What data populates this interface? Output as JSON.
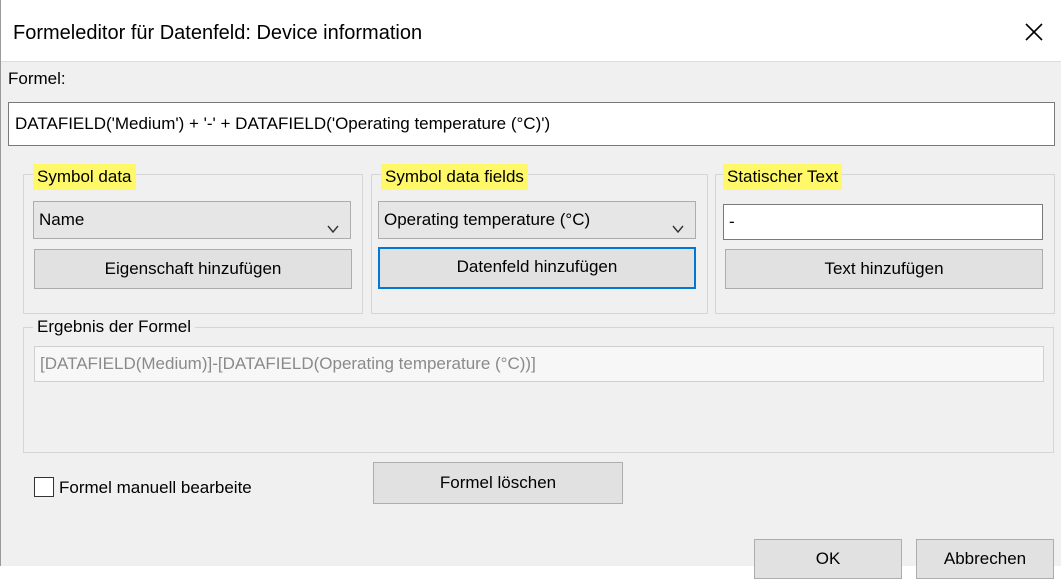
{
  "window": {
    "title": "Formeleditor für Datenfeld: Device information"
  },
  "formula": {
    "label": "Formel:",
    "value": "DATAFIELD('Medium') + '-' + DATAFIELD('Operating temperature (°C)')"
  },
  "symbol_data": {
    "title": "Symbol data",
    "selected": "Name",
    "button": "Eigenschaft hinzufügen"
  },
  "symbol_data_fields": {
    "title": "Symbol data fields",
    "selected": "Operating temperature (°C)",
    "button": "Datenfeld hinzufügen"
  },
  "static_text": {
    "title": "Statischer Text",
    "value": "-",
    "button": "Text hinzufügen"
  },
  "result": {
    "title": "Ergebnis der Formel",
    "value": "[DATAFIELD(Medium)]-[DATAFIELD(Operating temperature (°C))]"
  },
  "manual_edit": {
    "label": "Formel manuell bearbeite",
    "checked": false
  },
  "buttons": {
    "clear_formula": "Formel löschen",
    "ok": "OK",
    "cancel": "Abbrechen"
  },
  "colors": {
    "highlight": "#fff96a",
    "focus": "#0078d7",
    "dialog_bg": "#f0f0f0"
  }
}
